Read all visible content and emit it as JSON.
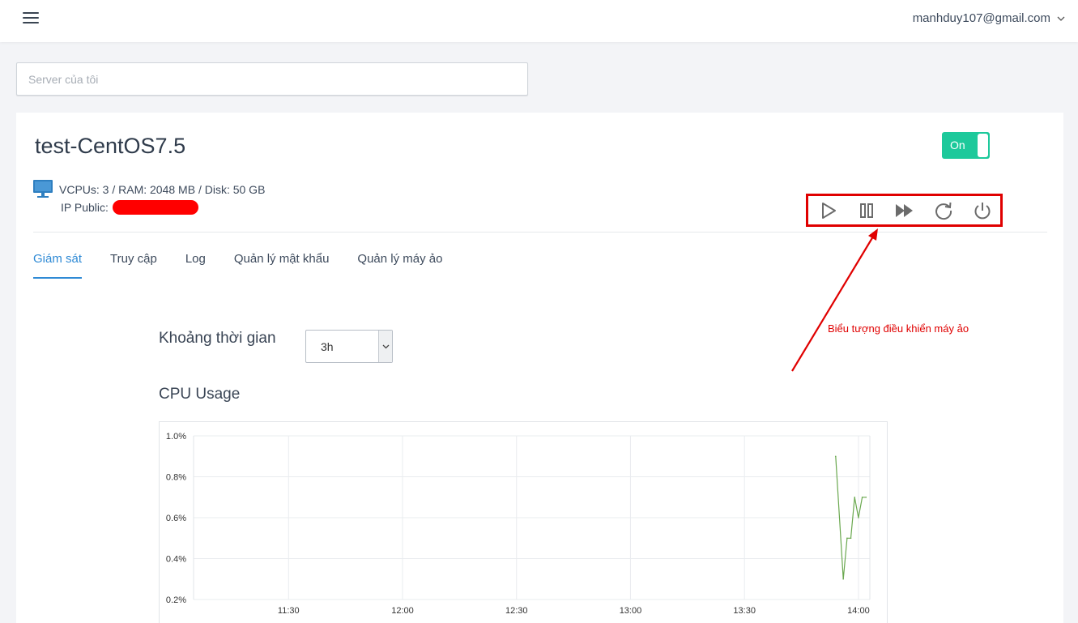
{
  "header": {
    "user_email": "manhduy107@gmail.com"
  },
  "search": {
    "placeholder": "Server của tôi"
  },
  "server": {
    "name": "test-CentOS7.5",
    "power_toggle_label": "On",
    "specs": "VCPUs: 3 / RAM: 2048 MB / Disk: 50 GB",
    "ip_label": "IP Public:",
    "controls": [
      "play-icon",
      "pause-icon",
      "fast-forward-icon",
      "restart-icon",
      "power-icon"
    ]
  },
  "tabs": [
    {
      "label": "Giám sát",
      "active": true
    },
    {
      "label": "Truy cập",
      "active": false
    },
    {
      "label": "Log",
      "active": false
    },
    {
      "label": "Quản lý mật khẩu",
      "active": false
    },
    {
      "label": "Quản lý máy ảo",
      "active": false
    }
  ],
  "monitoring": {
    "range_label": "Khoảng thời gian",
    "range_value": "3h",
    "cpu_title": "CPU Usage"
  },
  "annotation": {
    "text": "Biểu tượng điều khiển máy ảo",
    "color": "#e00000"
  },
  "colors": {
    "accent": "#2f8ad5",
    "toggle_on": "#1dc99b",
    "series_line": "#6aa84f"
  },
  "chart_data": {
    "type": "line",
    "title": "",
    "xlabel": "",
    "ylabel": "",
    "x_ticks": [
      "11:30",
      "12:00",
      "12:30",
      "13:00",
      "13:30",
      "14:00"
    ],
    "y_ticks": [
      "1.0%",
      "0.8%",
      "0.6%",
      "0.4%",
      "0.2%"
    ],
    "ylim": [
      0.2,
      1.0
    ],
    "xlim": [
      "11:05",
      "14:03"
    ],
    "grid": true,
    "series": [
      {
        "x": [
          "13:54",
          "13:56",
          "13:57",
          "13:58",
          "13:59",
          "14:00",
          "14:01",
          "14:02"
        ],
        "values": [
          0.9,
          0.3,
          0.5,
          0.5,
          0.7,
          0.6,
          0.7,
          0.7
        ]
      }
    ]
  }
}
